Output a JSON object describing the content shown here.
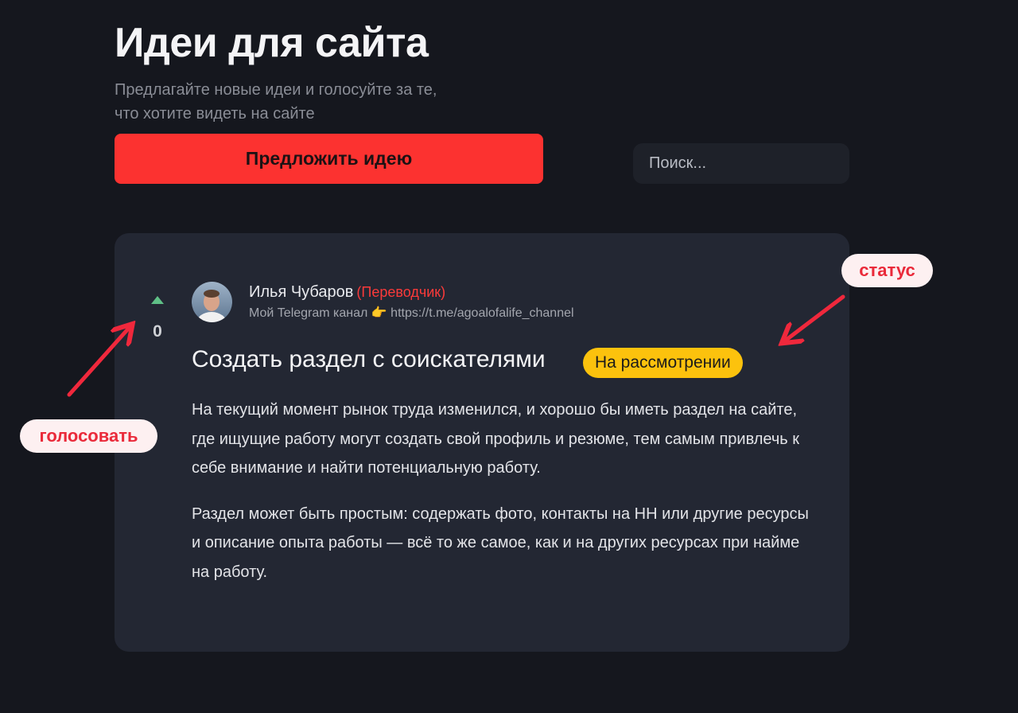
{
  "header": {
    "title": "Идеи для сайта",
    "subtitle": "Предлагайте новые идеи и голосуйте за те, что хотите видеть на сайте",
    "propose_button": "Предложить идею",
    "search_placeholder": "Поиск..."
  },
  "idea": {
    "votes": "0",
    "author": {
      "name": "Илья Чубаров",
      "role": "(Переводчик)",
      "bio": "Мой Telegram канал 👉 https://t.me/agoalofalife_channel"
    },
    "title": "Создать раздел с соискателями",
    "status": "На рассмотрении",
    "paragraphs": [
      "На текущий момент рынок труда изменился, и хорошо бы иметь раздел на сайте, где ищущие работу могут создать свой профиль и резюме, тем самым привлечь к себе внимание и найти потенциальную работу.",
      "Раздел может быть простым: содержать фото, контакты на HH или другие ресурсы и описание опыта работы — всё то же самое, как и на других ресурсах при найме на работу."
    ]
  },
  "annotations": {
    "status_label": "статус",
    "vote_label": "голосовать"
  },
  "colors": {
    "background": "#15171e",
    "card": "#232733",
    "accent_red": "#fc3230",
    "status_yellow": "#fcc20d",
    "vote_green": "#5fbf86",
    "annotation_red": "#ea2a3a"
  },
  "icons": {
    "vote": "upvote-triangle-icon",
    "arrow": "annotation-arrow-icon"
  }
}
